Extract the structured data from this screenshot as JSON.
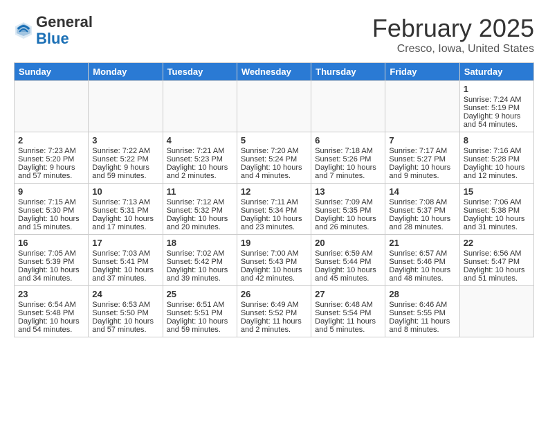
{
  "header": {
    "logo_general": "General",
    "logo_blue": "Blue",
    "month_title": "February 2025",
    "location": "Cresco, Iowa, United States"
  },
  "days_of_week": [
    "Sunday",
    "Monday",
    "Tuesday",
    "Wednesday",
    "Thursday",
    "Friday",
    "Saturday"
  ],
  "weeks": [
    [
      {
        "day": "",
        "content": ""
      },
      {
        "day": "",
        "content": ""
      },
      {
        "day": "",
        "content": ""
      },
      {
        "day": "",
        "content": ""
      },
      {
        "day": "",
        "content": ""
      },
      {
        "day": "",
        "content": ""
      },
      {
        "day": "1",
        "content": "Sunrise: 7:24 AM\nSunset: 5:19 PM\nDaylight: 9 hours and 54 minutes."
      }
    ],
    [
      {
        "day": "2",
        "content": "Sunrise: 7:23 AM\nSunset: 5:20 PM\nDaylight: 9 hours and 57 minutes."
      },
      {
        "day": "3",
        "content": "Sunrise: 7:22 AM\nSunset: 5:22 PM\nDaylight: 9 hours and 59 minutes."
      },
      {
        "day": "4",
        "content": "Sunrise: 7:21 AM\nSunset: 5:23 PM\nDaylight: 10 hours and 2 minutes."
      },
      {
        "day": "5",
        "content": "Sunrise: 7:20 AM\nSunset: 5:24 PM\nDaylight: 10 hours and 4 minutes."
      },
      {
        "day": "6",
        "content": "Sunrise: 7:18 AM\nSunset: 5:26 PM\nDaylight: 10 hours and 7 minutes."
      },
      {
        "day": "7",
        "content": "Sunrise: 7:17 AM\nSunset: 5:27 PM\nDaylight: 10 hours and 9 minutes."
      },
      {
        "day": "8",
        "content": "Sunrise: 7:16 AM\nSunset: 5:28 PM\nDaylight: 10 hours and 12 minutes."
      }
    ],
    [
      {
        "day": "9",
        "content": "Sunrise: 7:15 AM\nSunset: 5:30 PM\nDaylight: 10 hours and 15 minutes."
      },
      {
        "day": "10",
        "content": "Sunrise: 7:13 AM\nSunset: 5:31 PM\nDaylight: 10 hours and 17 minutes."
      },
      {
        "day": "11",
        "content": "Sunrise: 7:12 AM\nSunset: 5:32 PM\nDaylight: 10 hours and 20 minutes."
      },
      {
        "day": "12",
        "content": "Sunrise: 7:11 AM\nSunset: 5:34 PM\nDaylight: 10 hours and 23 minutes."
      },
      {
        "day": "13",
        "content": "Sunrise: 7:09 AM\nSunset: 5:35 PM\nDaylight: 10 hours and 26 minutes."
      },
      {
        "day": "14",
        "content": "Sunrise: 7:08 AM\nSunset: 5:37 PM\nDaylight: 10 hours and 28 minutes."
      },
      {
        "day": "15",
        "content": "Sunrise: 7:06 AM\nSunset: 5:38 PM\nDaylight: 10 hours and 31 minutes."
      }
    ],
    [
      {
        "day": "16",
        "content": "Sunrise: 7:05 AM\nSunset: 5:39 PM\nDaylight: 10 hours and 34 minutes."
      },
      {
        "day": "17",
        "content": "Sunrise: 7:03 AM\nSunset: 5:41 PM\nDaylight: 10 hours and 37 minutes."
      },
      {
        "day": "18",
        "content": "Sunrise: 7:02 AM\nSunset: 5:42 PM\nDaylight: 10 hours and 39 minutes."
      },
      {
        "day": "19",
        "content": "Sunrise: 7:00 AM\nSunset: 5:43 PM\nDaylight: 10 hours and 42 minutes."
      },
      {
        "day": "20",
        "content": "Sunrise: 6:59 AM\nSunset: 5:44 PM\nDaylight: 10 hours and 45 minutes."
      },
      {
        "day": "21",
        "content": "Sunrise: 6:57 AM\nSunset: 5:46 PM\nDaylight: 10 hours and 48 minutes."
      },
      {
        "day": "22",
        "content": "Sunrise: 6:56 AM\nSunset: 5:47 PM\nDaylight: 10 hours and 51 minutes."
      }
    ],
    [
      {
        "day": "23",
        "content": "Sunrise: 6:54 AM\nSunset: 5:48 PM\nDaylight: 10 hours and 54 minutes."
      },
      {
        "day": "24",
        "content": "Sunrise: 6:53 AM\nSunset: 5:50 PM\nDaylight: 10 hours and 57 minutes."
      },
      {
        "day": "25",
        "content": "Sunrise: 6:51 AM\nSunset: 5:51 PM\nDaylight: 10 hours and 59 minutes."
      },
      {
        "day": "26",
        "content": "Sunrise: 6:49 AM\nSunset: 5:52 PM\nDaylight: 11 hours and 2 minutes."
      },
      {
        "day": "27",
        "content": "Sunrise: 6:48 AM\nSunset: 5:54 PM\nDaylight: 11 hours and 5 minutes."
      },
      {
        "day": "28",
        "content": "Sunrise: 6:46 AM\nSunset: 5:55 PM\nDaylight: 11 hours and 8 minutes."
      },
      {
        "day": "",
        "content": ""
      }
    ]
  ]
}
